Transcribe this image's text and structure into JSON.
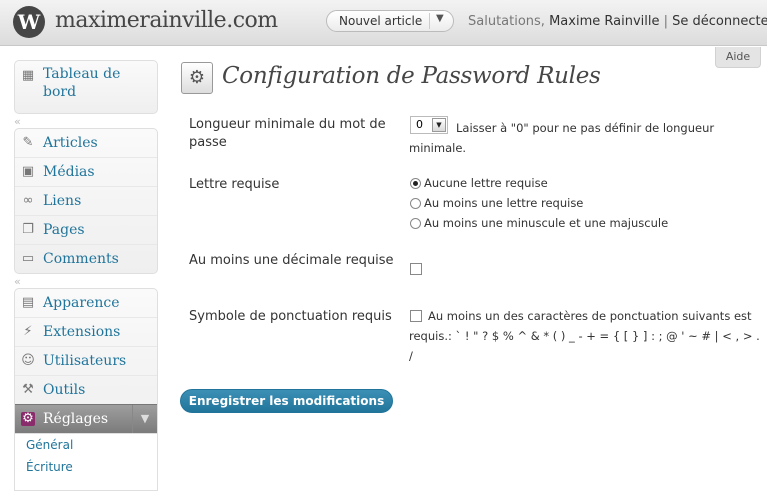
{
  "header": {
    "site_title": "maximerainville.com",
    "favorite_action": "Nouvel article",
    "greeting_prefix": "Salutations,",
    "user_name": "Maxime Rainville",
    "separator": "|",
    "logout": "Se déconnecter",
    "help": "Aide"
  },
  "sidebar": {
    "dashboard": "Tableau de bord",
    "items_a": [
      "Articles",
      "Médias",
      "Liens",
      "Pages",
      "Comments"
    ],
    "items_b": [
      "Apparence",
      "Extensions",
      "Utilisateurs",
      "Outils",
      "Réglages"
    ],
    "submenu": [
      "Général",
      "Écriture"
    ]
  },
  "page": {
    "title": "Configuration de Password Rules"
  },
  "form": {
    "min_length": {
      "label": "Longueur minimale du mot de passe",
      "value": "0",
      "hint": "Laisser à \"0\" pour ne pas définir de longueur minimale."
    },
    "letter": {
      "label": "Lettre requise",
      "options": [
        "Aucune lettre requise",
        "Au moins une lettre requise",
        "Au moins une minuscule et une majuscule"
      ],
      "selected": "Aucune lettre requise"
    },
    "decimal": {
      "label": "Au moins une décimale requise",
      "checked": false
    },
    "punct": {
      "label": "Symbole de ponctuation requis",
      "desc": "Au moins un des caractères de ponctuation suivants est requis.: ` ! \" ? $ % ^ & * ( ) _ - + = { [ } ] : ; @ ' ~ # | < , > . /",
      "checked": false
    },
    "submit": "Enregistrer les modifications"
  }
}
